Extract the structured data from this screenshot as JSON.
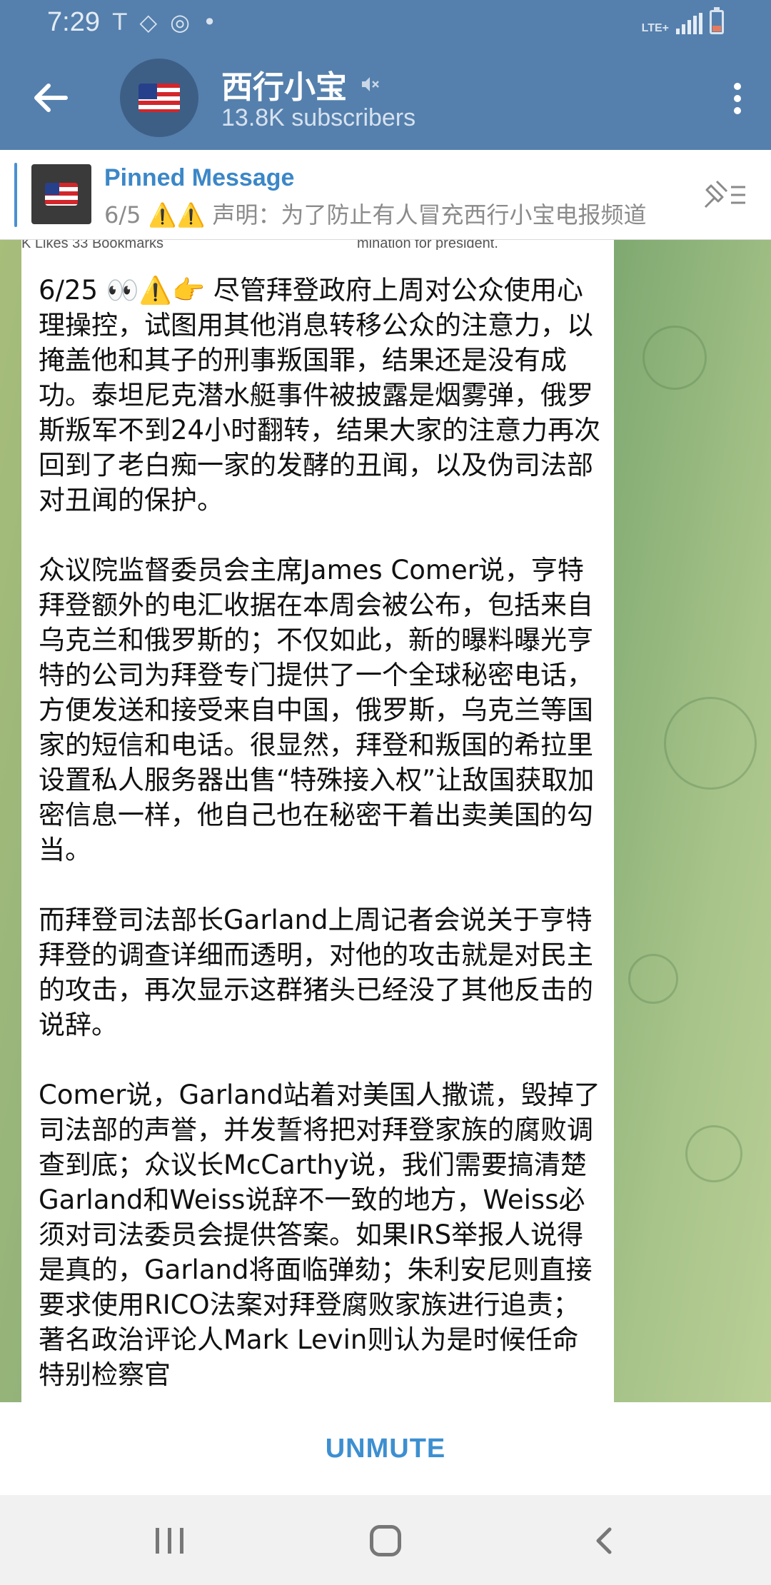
{
  "status_bar": {
    "time": "7:29",
    "network": "LTE+"
  },
  "header": {
    "title": "西行小宝",
    "subtitle": "13.8K subscribers"
  },
  "pinned": {
    "title": "Pinned Message",
    "text": "6/5 ⚠️⚠️ 声明：为了防止有人冒充西行小宝电报频道"
  },
  "message": {
    "cropped_top_left": "K Likes  33 Bookmarks",
    "cropped_top_right": "mination for president.",
    "text": "6/25 👀⚠️👉 尽管拜登政府上周对公众使用心理操控，试图用其他消息转移公众的注意力，以掩盖他和其子的刑事叛国罪，结果还是没有成功。泰坦尼克潜水艇事件被披露是烟雾弹，俄罗斯叛军不到24小时翻转，结果大家的注意力再次回到了老白痴一家的发酵的丑闻，以及伪司法部对丑闻的保护。\n\n众议院监督委员会主席James Comer说，亨特拜登额外的电汇收据在本周会被公布，包括来自乌克兰和俄罗斯的；不仅如此，新的曝料曝光亨特的公司为拜登专门提供了一个全球秘密电话，方便发送和接受来自中国，俄罗斯，乌克兰等国家的短信和电话。很显然，拜登和叛国的希拉里设置私人服务器出售“特殊接入权”让敌国获取加密信息一样，他自己也在秘密干着出卖美国的勾当。\n\n而拜登司法部长Garland上周记者会说关于亨特拜登的调查详细而透明，对他的攻击就是对民主的攻击，再次显示这群猪头已经没了其他反击的说辞。\n\nComer说，Garland站着对美国人撒谎，毁掉了司法部的声誉，并发誓将把对拜登家族的腐败调查到底；众议长McCarthy说，我们需要搞清楚Garland和Weiss说辞不一致的地方，Weiss必须对司法委员会提供答案。如果IRS举报人说得是真的，Garland将面临弹劾；朱利安尼则直接要求使用RICO法案对拜登腐败家族进行追责；著名政治评论人Mark Levin则认为是时候任命特别检察官"
  },
  "bottom": {
    "unmute_label": "UNMUTE"
  },
  "colors": {
    "header": "#5580ad",
    "accent": "#3d8fd0",
    "pinned_title": "#3b87c8"
  },
  "icons": [
    "back-arrow-icon",
    "mute-icon",
    "more-vert-icon",
    "unpin-icon",
    "recents-icon",
    "home-icon",
    "nav-back-icon"
  ]
}
